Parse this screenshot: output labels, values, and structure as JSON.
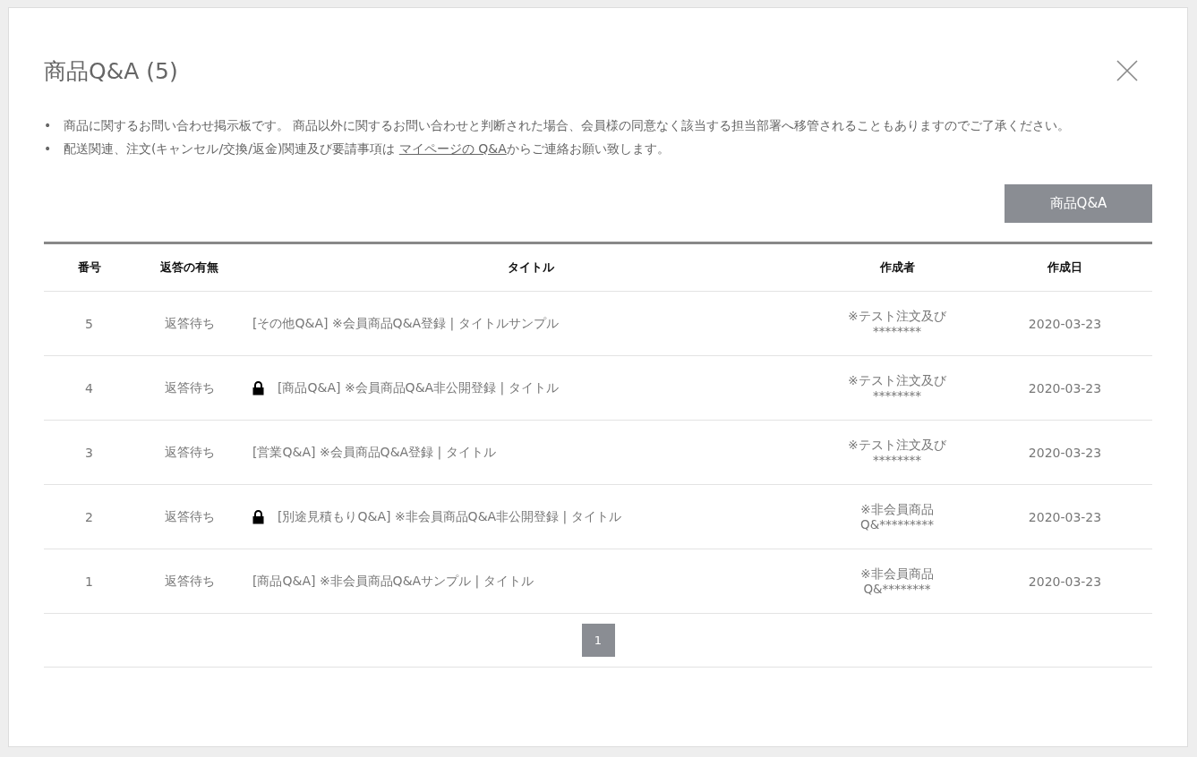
{
  "dialog": {
    "title": "商品Q&A (5)"
  },
  "notices": [
    {
      "marker": "•",
      "text": "商品に関するお問い合わせ掲示板です。 商品以外に関するお問い合わせと判断された場合、会員様の同意なく該当する担当部署へ移管されることもありますのでご了承ください。"
    },
    {
      "marker": "•",
      "text": "配送関連、注文(キャンセル/交換/返金)関連及び要請事項は ",
      "link": "マイページの Q&A",
      "after": "からご連絡お願い致します。"
    }
  ],
  "action_button": "商品Q&A",
  "table": {
    "columns": [
      "番号",
      "返答の有無",
      "タイトル",
      "作成者",
      "作成日"
    ],
    "rows": [
      {
        "number": "5",
        "status": "返答待ち",
        "locked": false,
        "title": "[その他Q&A] ※会員商品Q&A登録 | タイトルサンプル",
        "author": "※テスト注文及び\n********",
        "date": "2020-03-23"
      },
      {
        "number": "4",
        "status": "返答待ち",
        "locked": true,
        "title": "[商品Q&A] ※会員商品Q&A非公開登録 | タイトル",
        "author": "※テスト注文及び\n********",
        "date": "2020-03-23"
      },
      {
        "number": "3",
        "status": "返答待ち",
        "locked": false,
        "title": "[営業Q&A] ※会員商品Q&A登録 | タイトル",
        "author": "※テスト注文及び\n********",
        "date": "2020-03-23"
      },
      {
        "number": "2",
        "status": "返答待ち",
        "locked": true,
        "title": "[別途見積もりQ&A] ※非会員商品Q&A非公開登録 | タイトル",
        "author": "※非会員商品\nQ&*********",
        "date": "2020-03-23"
      },
      {
        "number": "1",
        "status": "返答待ち",
        "locked": false,
        "title": "[商品Q&A] ※非会員商品Q&Aサンプル | タイトル",
        "author": "※非会員商品\nQ&********",
        "date": "2020-03-23"
      }
    ]
  },
  "pagination": [
    {
      "label": "1",
      "selected": true
    }
  ]
}
